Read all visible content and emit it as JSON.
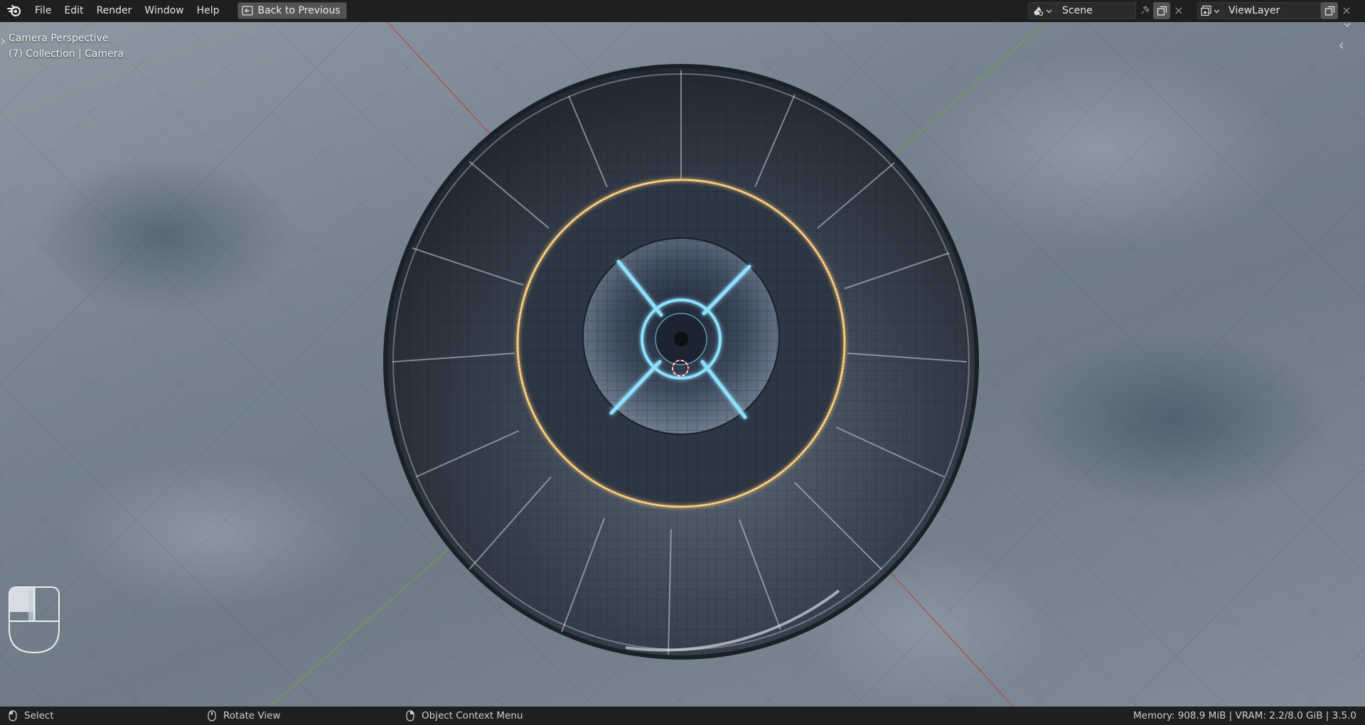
{
  "menu": {
    "file": "File",
    "edit": "Edit",
    "render": "Render",
    "window": "Window",
    "help": "Help",
    "back_button": "Back to Previous"
  },
  "scene_selector": {
    "value": "Scene"
  },
  "viewlayer_selector": {
    "value": "ViewLayer"
  },
  "viewport": {
    "view_name": "Camera Perspective",
    "collection_info": "(7) Collection | Camera"
  },
  "statusbar": {
    "left_action": "Select",
    "middle_action": "Rotate View",
    "right_action": "Object Context Menu",
    "stats": "Memory: 908.9 MiB | VRAM: 2.2/8.0 GiB | 3.5.0"
  },
  "colors": {
    "x_axis": "#c0393b",
    "y_axis": "#7aa33a",
    "glow_ring": "#f0c070",
    "light_cross": "#8fe0ff"
  }
}
